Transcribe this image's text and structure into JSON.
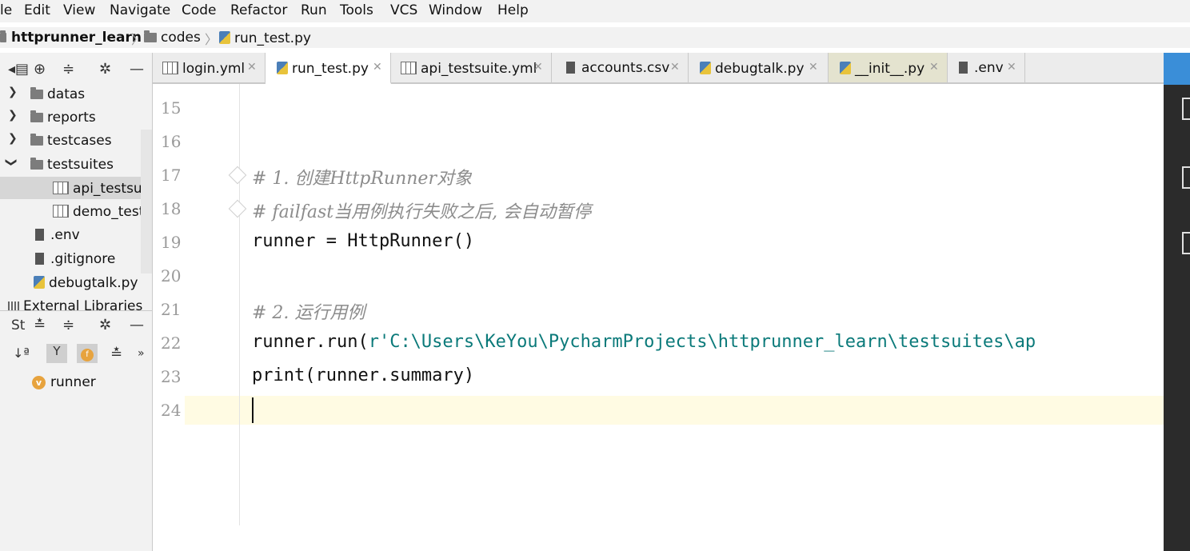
{
  "menu": [
    "le",
    "Edit",
    "View",
    "Navigate",
    "Code",
    "Refactor",
    "Run",
    "Tools",
    "VCS",
    "Window",
    "Help"
  ],
  "breadcrumb": {
    "project": "httprunner_learn",
    "folder": "codes",
    "file": "run_test.py"
  },
  "project_tree": [
    {
      "label": "datas",
      "type": "folder"
    },
    {
      "label": "reports",
      "type": "folder"
    },
    {
      "label": "testcases",
      "type": "folder"
    },
    {
      "label": "testsuites",
      "type": "folder-open"
    },
    {
      "label": "api_testsuite",
      "type": "table",
      "selected": true
    },
    {
      "label": "demo_testsu",
      "type": "table"
    },
    {
      "label": ".env",
      "type": "file"
    },
    {
      "label": ".gitignore",
      "type": "file"
    },
    {
      "label": "debugtalk.py",
      "type": "python"
    },
    {
      "label": "External Libraries",
      "type": "library"
    }
  ],
  "structure": {
    "title": "St",
    "items": [
      {
        "label": "runner",
        "badge": "v"
      }
    ]
  },
  "tabs": [
    {
      "label": "login.yml",
      "active": false
    },
    {
      "label": "run_test.py",
      "active": true
    },
    {
      "label": "api_testsuite.yml",
      "active": false
    },
    {
      "label": "accounts.csv",
      "active": false
    },
    {
      "label": "debugtalk.py",
      "active": false
    },
    {
      "label": "__init__.py",
      "active": false
    },
    {
      "label": ".env",
      "active": false
    }
  ],
  "editor": {
    "lines": [
      {
        "num": "15",
        "text": ""
      },
      {
        "num": "16",
        "text": ""
      },
      {
        "num": "17",
        "text": "# 1. 创建HttpRunner对象"
      },
      {
        "num": "18",
        "text": "# failfast当用例执行失败之后, 会自动暂停"
      },
      {
        "num": "19",
        "text": "runner = HttpRunner()"
      },
      {
        "num": "20",
        "text": ""
      },
      {
        "num": "21",
        "text": "# 2. 运行用例"
      },
      {
        "num": "22",
        "text_prefix": "runner.run(",
        "text_string": "r'C:\\Users\\KeYou\\PycharmProjects\\httprunner_learn\\testsuites\\ap"
      },
      {
        "num": "23",
        "text": "print(runner.summary)"
      },
      {
        "num": "24",
        "text": ""
      }
    ]
  },
  "colors": {
    "comment": "#8c8c8c",
    "string": "#0b7a7a",
    "caret_line": "#fffbe3",
    "right_accent": "#3a8ed8"
  }
}
